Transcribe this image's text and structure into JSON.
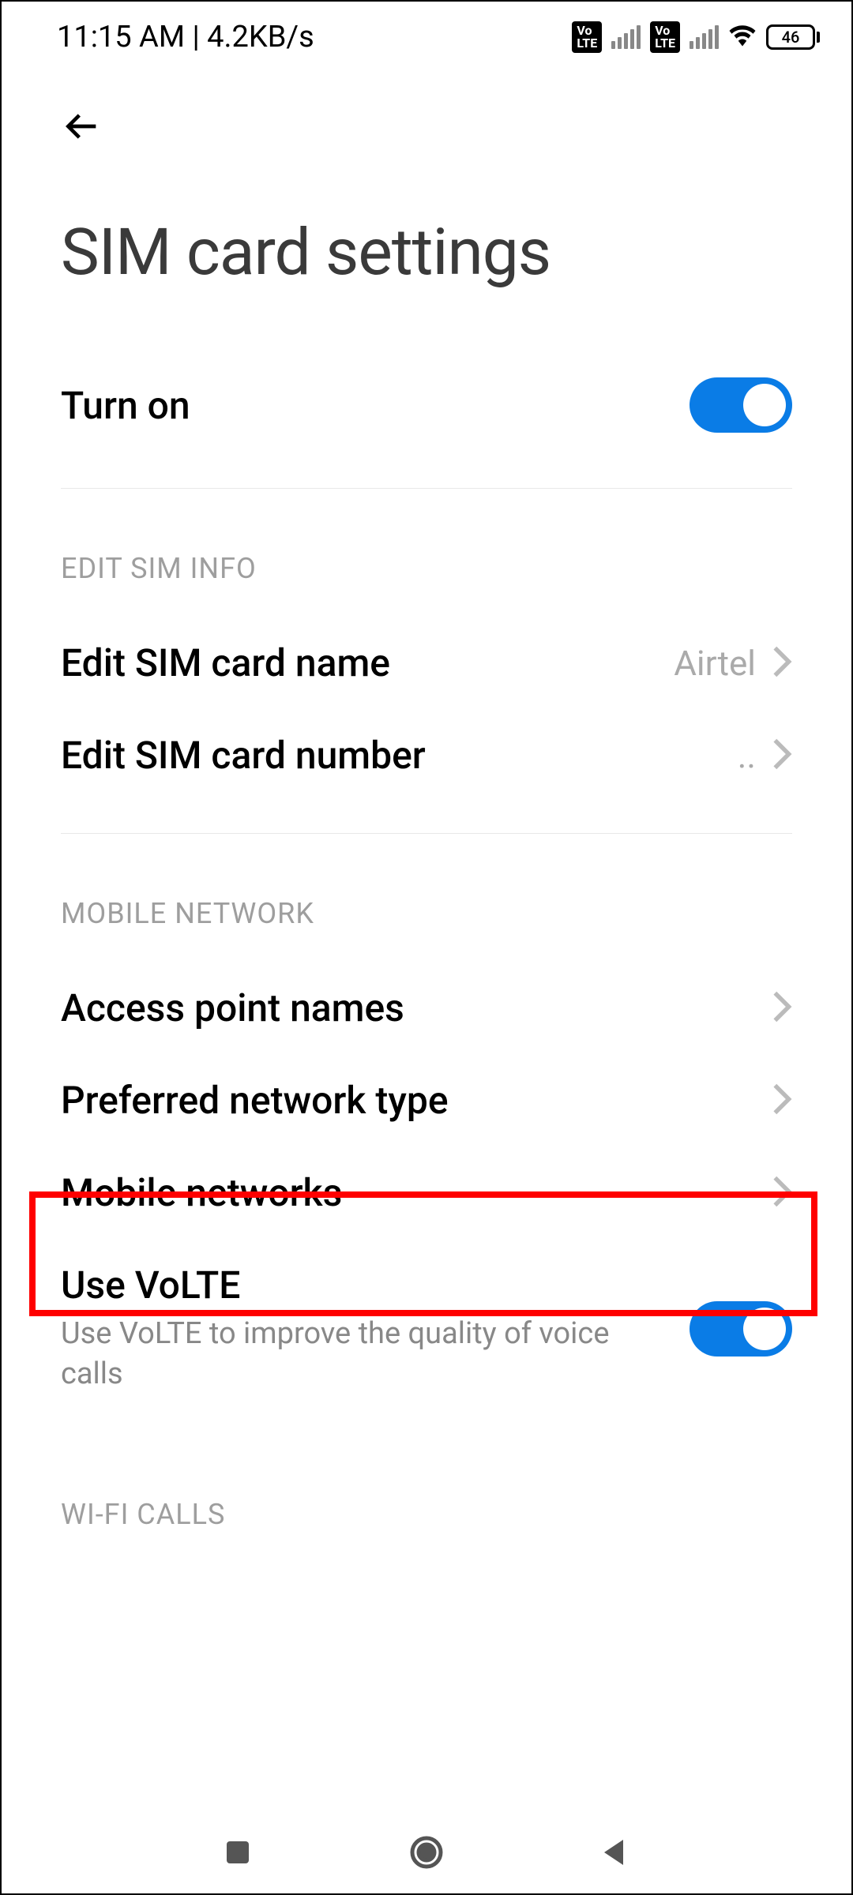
{
  "status": {
    "time": "11:15 AM",
    "speed": "4.2KB/s",
    "battery": "46"
  },
  "page": {
    "title": "SIM card settings"
  },
  "turnOn": {
    "label": "Turn on",
    "enabled": true
  },
  "sections": {
    "editSimInfo": {
      "header": "EDIT SIM INFO",
      "editName": {
        "label": "Edit SIM card name",
        "value": "Airtel"
      },
      "editNumber": {
        "label": "Edit SIM card number",
        "value": ".."
      }
    },
    "mobileNetwork": {
      "header": "MOBILE NETWORK",
      "apn": {
        "label": "Access point names"
      },
      "preferredNetwork": {
        "label": "Preferred network type"
      },
      "mobileNetworks": {
        "label": "Mobile networks"
      },
      "volte": {
        "label": "Use VoLTE",
        "description": "Use VoLTE to improve the quality of voice calls",
        "enabled": true
      }
    },
    "wifiCalls": {
      "header": "WI-FI CALLS"
    }
  }
}
